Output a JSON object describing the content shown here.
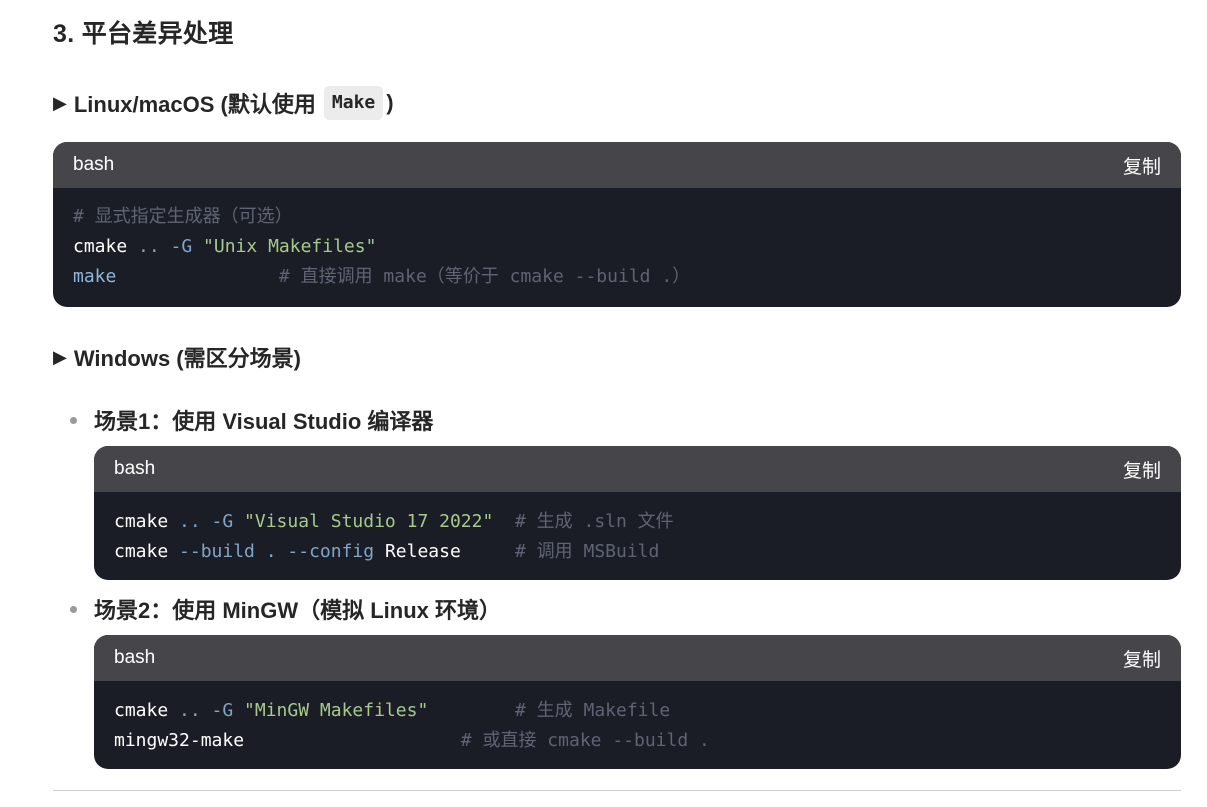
{
  "section": {
    "title": "3. 平台差异处理"
  },
  "linux": {
    "heading_arrow": "▶",
    "heading_prefix": "Linux/macOS (默认使用",
    "heading_code": "Make",
    "heading_suffix": ")",
    "code": {
      "lang": "bash",
      "copy": "复制",
      "line1_comment": "# 显式指定生成器（可选）",
      "line2_cmd": "cmake",
      "line2_op": " .. -G ",
      "line2_str": "\"Unix Makefiles\"",
      "line3_kw": "make",
      "line3_pad": "               ",
      "line3_comment": "# 直接调用 make（等价于 cmake --build .）"
    }
  },
  "windows": {
    "heading_arrow": "▶",
    "heading": "Windows (需区分场景)",
    "scenario1": {
      "title": "场景1：使用 Visual Studio 编译器",
      "code": {
        "lang": "bash",
        "copy": "复制",
        "l1_cmd": "cmake",
        "l1_op": " .. -G ",
        "l1_str": "\"Visual Studio 17 2022\"",
        "l1_pad": "  ",
        "l1_comment": "# 生成 .sln 文件",
        "l2_cmd": "cmake",
        "l2_op": " --build . --config ",
        "l2_plain": "Release",
        "l2_pad": "     ",
        "l2_comment": "# 调用 MSBuild"
      }
    },
    "scenario2": {
      "title": "场景2：使用 MinGW（模拟 Linux 环境）",
      "code": {
        "lang": "bash",
        "copy": "复制",
        "l1_cmd": "cmake",
        "l1_op": " .. -G ",
        "l1_str": "\"MinGW Makefiles\"",
        "l1_pad": "        ",
        "l1_comment": "# 生成 Makefile",
        "l2_cmd": "mingw32-make",
        "l2_pad": "                    ",
        "l2_comment": "# 或直接 cmake --build ."
      }
    }
  }
}
